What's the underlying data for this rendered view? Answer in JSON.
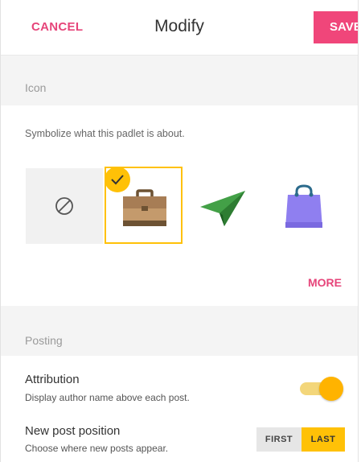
{
  "header": {
    "cancel_label": "CANCEL",
    "title": "Modify",
    "save_label": "SAVE"
  },
  "icon_section": {
    "label": "Icon",
    "hint": "Symbolize what this padlet is about.",
    "options": [
      "none-icon",
      "briefcase-icon",
      "paper-plane-icon",
      "shopping-bag-icon"
    ],
    "selected": "briefcase-icon",
    "more_label": "MORE"
  },
  "posting_section": {
    "label": "Posting",
    "attribution": {
      "title": "Attribution",
      "description": "Display author name above each post.",
      "enabled": true
    },
    "new_post_position": {
      "title": "New post position",
      "description": "Choose where new posts appear.",
      "options": [
        "FIRST",
        "LAST"
      ],
      "selected": "LAST"
    }
  },
  "colors": {
    "accent": "#f0467a",
    "selection": "#ffc107",
    "toggle_on": "#ffb300"
  }
}
